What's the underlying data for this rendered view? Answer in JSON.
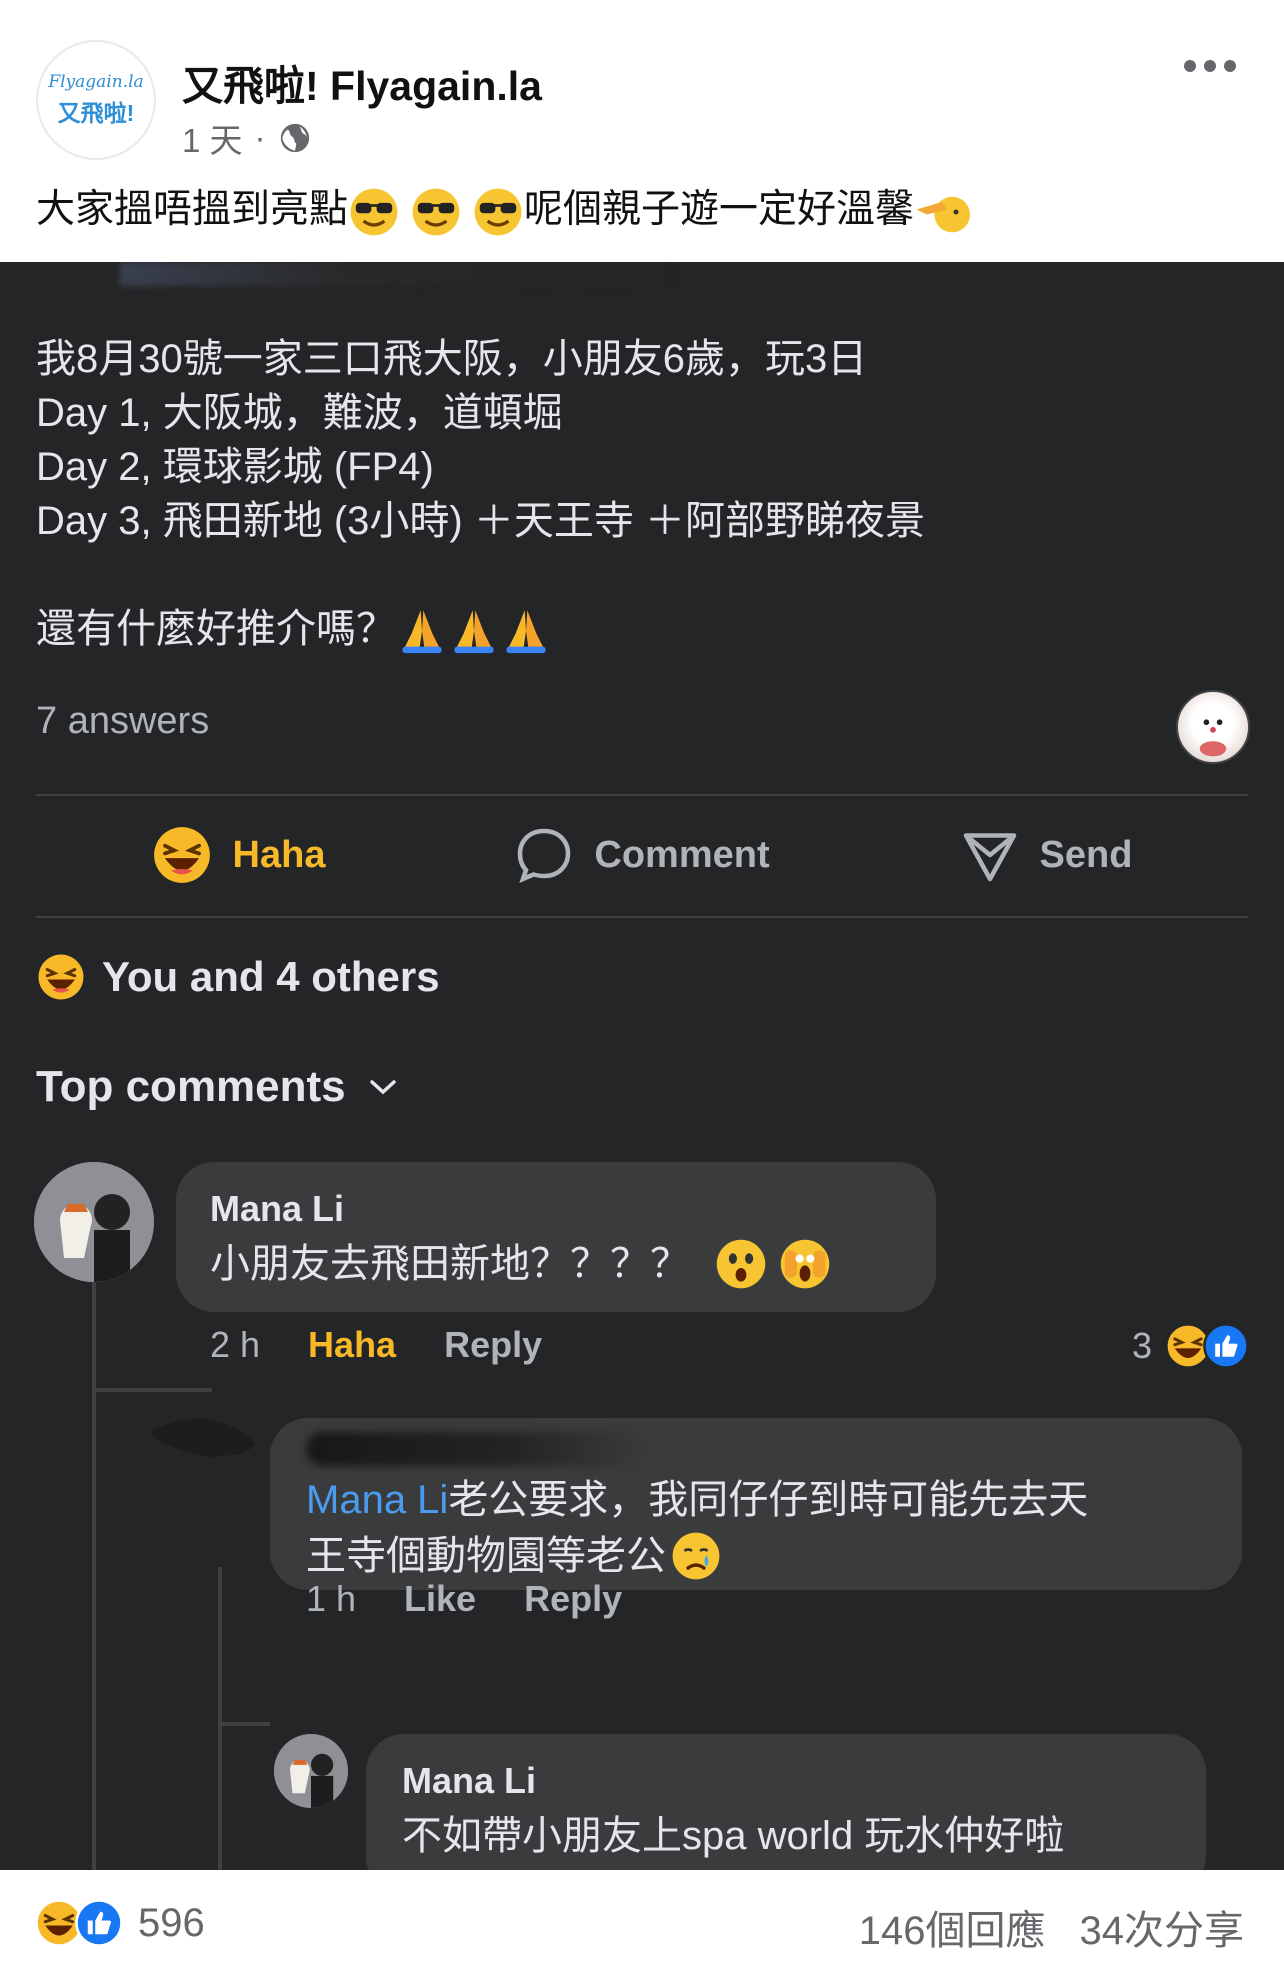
{
  "page": {
    "name": "又飛啦! Flyagain.la",
    "logo_text_top": "Flyagain.la",
    "logo_text_bottom": "又飛啦!",
    "time": "1 天",
    "separator": "·",
    "icons": [
      "globe-icon",
      "more-icon"
    ]
  },
  "caption": {
    "text": "大家搵唔搵到亮點",
    "emojis": [
      "sunglasses-emoji",
      "sunglasses-emoji",
      "sunglasses-emoji"
    ],
    "text2": "呢個親子遊一定好溫馨",
    "end_emoji": "pointing-hand-emoji"
  },
  "question": {
    "lines": [
      "我8月30號一家三口飛大阪，小朋友6歲，玩3日",
      "Day 1, 大阪城，難波，道頓堀",
      "Day 2, 環球影城 (FP4)",
      "Day 3, 飛田新地 (3小時) ＋天王寺 ＋阿部野睇夜景"
    ],
    "last_line": "還有什麼好推介嗎？",
    "last_emojis": [
      "pray-emoji",
      "pray-emoji",
      "pray-emoji"
    ],
    "answers_count": "7 answers"
  },
  "actions": {
    "haha": "Haha",
    "comment": "Comment",
    "send": "Send"
  },
  "reactions_summary": "You and 4 others",
  "top_comments_label": "Top comments",
  "comments": [
    {
      "author": "Mana Li",
      "text": "小朋友去飛田新地？？？？",
      "emojis": [
        "astonished-emoji",
        "scream-emoji"
      ],
      "time": "2 h",
      "reaction_label": "Haha",
      "reply_label": "Reply",
      "reaction_count": "3"
    },
    {
      "mention": "Mana Li",
      "text_line1": "老公要求，我同仔仔到時可能先去天",
      "text_line2": "王寺個動物園等老公",
      "emoji": "crying-emoji",
      "time": "1 h",
      "like_label": "Like",
      "reply_label": "Reply"
    },
    {
      "author": "Mana Li",
      "text": "不如帶小朋友上spa world 玩水仲好啦"
    }
  ],
  "footer": {
    "reaction_count": "596",
    "comments_count": "146個回應",
    "shares_count": "34次分享"
  },
  "colors": {
    "dark_bg": "#242526",
    "bubble": "#3a3b3c",
    "haha_yellow": "#f7b928",
    "mention_blue": "#4b9cf0",
    "like_blue": "#1877f2"
  }
}
